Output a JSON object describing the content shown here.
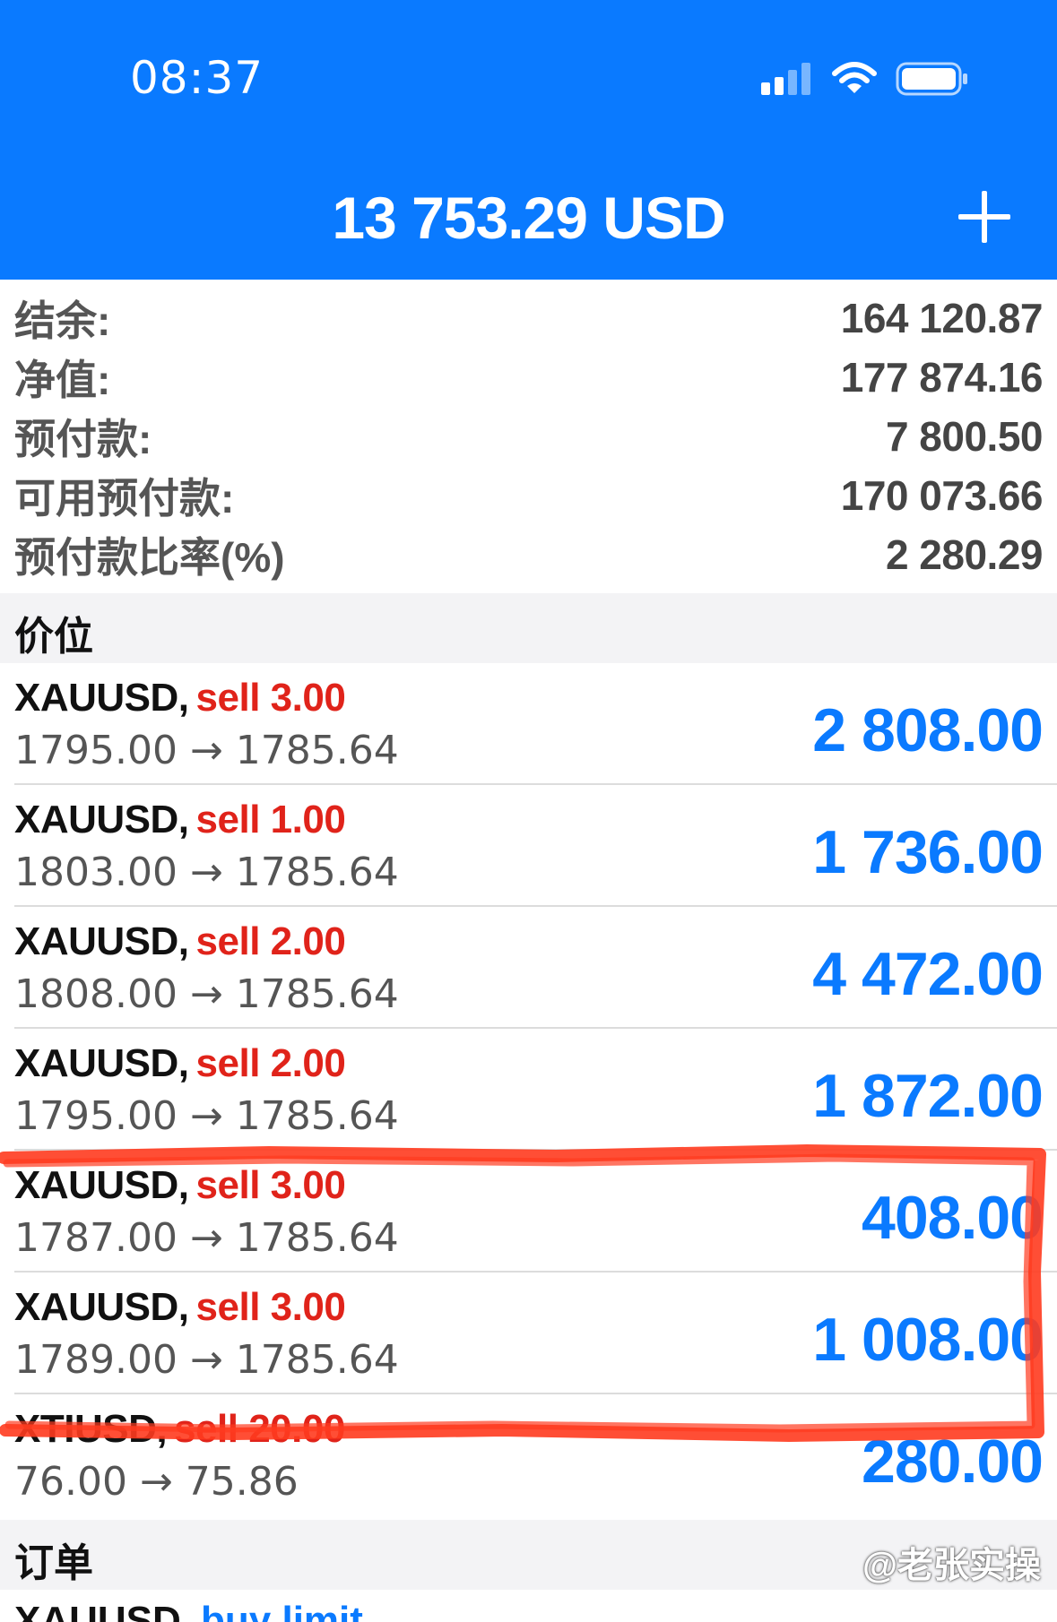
{
  "status_bar": {
    "time": "08:37",
    "icons": [
      "cellular-icon",
      "wifi-icon",
      "battery-icon"
    ]
  },
  "header": {
    "title": "13 753.29 USD",
    "add_icon": "plus-icon"
  },
  "account": {
    "rows": [
      {
        "label": "结余:",
        "value": "164 120.87"
      },
      {
        "label": "净值:",
        "value": "177 874.16"
      },
      {
        "label": "预付款:",
        "value": "7 800.50"
      },
      {
        "label": "可用预付款:",
        "value": "170 073.66"
      },
      {
        "label": "预付款比率(%)",
        "value": "2 280.29"
      }
    ]
  },
  "positions_section": {
    "title": "价位"
  },
  "positions": [
    {
      "symbol": "XAUUSD,",
      "type": "sell 3.00",
      "prices": "1795.00 → 1785.64",
      "profit": "2 808.00"
    },
    {
      "symbol": "XAUUSD,",
      "type": "sell 1.00",
      "prices": "1803.00 → 1785.64",
      "profit": "1 736.00"
    },
    {
      "symbol": "XAUUSD,",
      "type": "sell 2.00",
      "prices": "1808.00 → 1785.64",
      "profit": "4 472.00"
    },
    {
      "symbol": "XAUUSD,",
      "type": "sell 2.00",
      "prices": "1795.00 → 1785.64",
      "profit": "1 872.00"
    },
    {
      "symbol": "XAUUSD,",
      "type": "sell 3.00",
      "prices": "1787.00 → 1785.64",
      "profit": "408.00"
    },
    {
      "symbol": "XAUUSD,",
      "type": "sell 3.00",
      "prices": "1789.00 → 1785.64",
      "profit": "1 008.00"
    },
    {
      "symbol": "XTIUSD,",
      "type": "sell 20.00",
      "prices": "76.00 → 75.86",
      "profit": "280.00"
    }
  ],
  "orders_section": {
    "title": "订单"
  },
  "orders": [
    {
      "symbol": "XAUUSD,",
      "type": "buy limit"
    }
  ],
  "watermark": "@老张实操",
  "colors": {
    "header": "#0a7aff",
    "profit": "#0a7aff",
    "sell": "#e0231a",
    "annotation": "#ff3b1f"
  }
}
